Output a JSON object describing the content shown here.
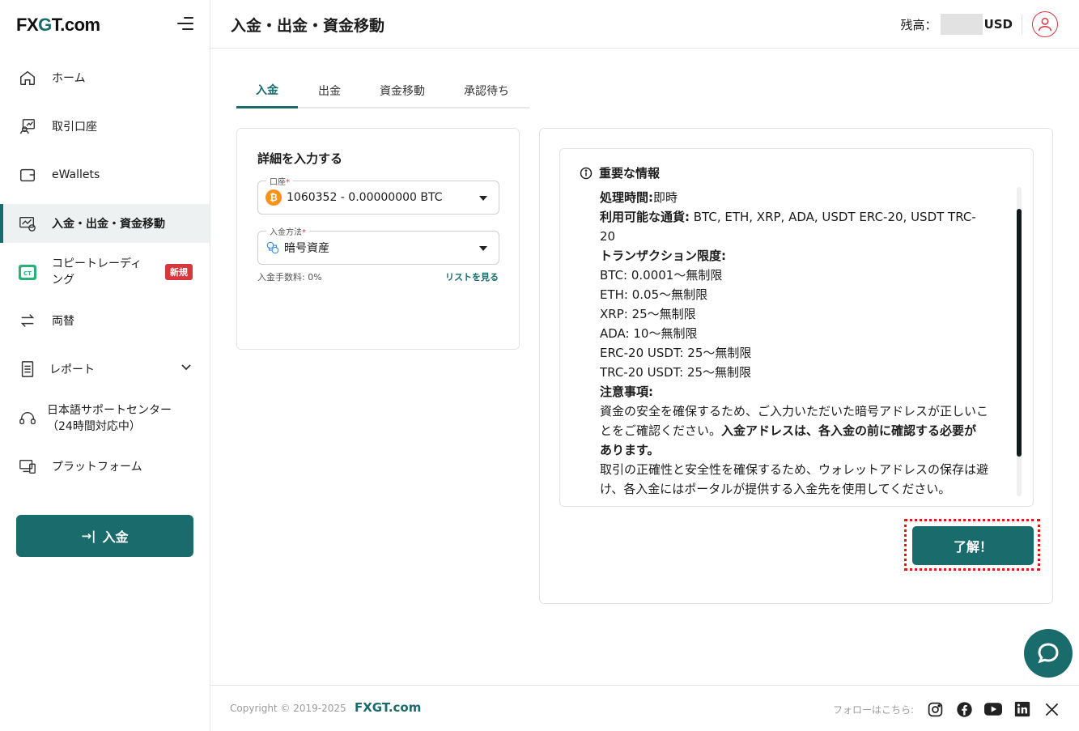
{
  "brand": {
    "logo_prefix": "FX",
    "logo_g": "G",
    "logo_suffix": "T.com"
  },
  "sidebar": {
    "items": [
      {
        "label": "ホーム",
        "icon": "home-icon"
      },
      {
        "label": "取引口座",
        "icon": "trading-account-icon"
      },
      {
        "label": "eWallets",
        "icon": "wallet-icon"
      },
      {
        "label": "入金・出金・資金移動",
        "icon": "deposit-withdraw-icon",
        "active": true
      },
      {
        "label": "コピートレーディング",
        "icon": "copy-trading-icon",
        "badge": "新規"
      },
      {
        "label": "両替",
        "icon": "exchange-icon"
      },
      {
        "label": "レポート",
        "icon": "report-icon"
      },
      {
        "label": "日本語サポートセンター（24時間対応中）",
        "icon": "headset-icon"
      },
      {
        "label": "プラットフォーム",
        "icon": "platform-icon"
      }
    ],
    "copy_trading_line1": "コピートレーディ",
    "copy_trading_line2": "ング",
    "support_line1": "日本語サポートセンター",
    "support_line2": "（24時間対応中）",
    "deposit_button": "入金"
  },
  "header": {
    "title": "入金・出金・資金移動",
    "balance_label": "残高：",
    "balance_currency": "USD"
  },
  "tabs": [
    "入金",
    "出金",
    "資金移動",
    "承認待ち"
  ],
  "form": {
    "title": "詳細を入力する",
    "account_label": "口座",
    "account_value": "1060352 - 0.00000000 BTC",
    "method_label": "入金方法",
    "method_value": "暗号資産",
    "required_mark": "*",
    "fee_text": "入金手数料: 0%",
    "list_link": "リストを見る"
  },
  "info": {
    "heading": "重要な情報",
    "processing_label": "処理時間:",
    "processing_value": "即時",
    "currencies_label": "利用可能な通貨:",
    "currencies_value": " BTC, ETH, XRP, ADA, USDT ERC-20, USDT TRC-20",
    "limits_label": "トランザクション限度:",
    "limits": [
      "BTC: 0.0001〜無制限",
      "ETH: 0.05〜無制限",
      "XRP: 25〜無制限",
      "ADA: 10〜無制限",
      "ERC-20 USDT: 25〜無制限",
      "TRC-20 USDT: 25〜無制限"
    ],
    "notes_label": "注意事項:",
    "note1": "資金の安全を確保するため、ご入力いただいた暗号アドレスが正しいことをご確認ください。",
    "note1_bold": "入金アドレスは、各入金の前に確認する必要があります。",
    "note2": "取引の正確性と安全性を確保するため、ウォレットアドレスの保存は避け、各入金にはポータルが提供する入金先を使用してください。"
  },
  "ok_button": "了解！",
  "footer": {
    "copyright": "Copyright © 2019-2025",
    "brand": "FXGT.com",
    "follow": "フォローはこちら:"
  },
  "colors": {
    "accent": "#1a6b6b",
    "badge": "#d9363e",
    "highlight_border": "#ee1111"
  }
}
